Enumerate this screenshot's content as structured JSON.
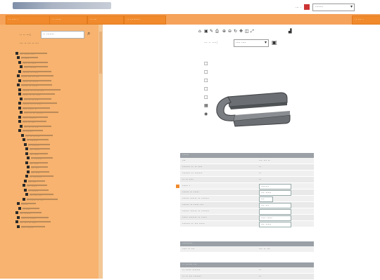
{
  "header": {
    "lang_label": "··· ·",
    "lang_value": "·······"
  },
  "nav": {
    "tabs": [
      "·· ···· ·",
      "·· ·····",
      "·· ···",
      "·· ·········"
    ],
    "right_tab": "·· ··· ·"
  },
  "sidebar": {
    "search_label": "·· ·· ···:",
    "search_value": "·· ·······",
    "hint": "··· ·· ··· ·· ···",
    "tree_items": [
      "··· ····· ···",
      "·· ····",
      "···· ·· ····",
      "···· ······",
      "······ ·· ····",
      "····· ··· ·· ···",
      "····· ·· ·····",
      "······ ·· ·····",
      "······ ·· ·· ·· ···",
      "····· ·· ·· ····",
      "··· ·· ·· ···",
      "······ ·· ·· ····",
      "···· ····· ··",
      "···· ·· ·· ······",
      "····· ······",
      "···· ·· ···",
      "··· ·· ·· ···",
      "·· ······",
      "··· ·· ·· ···",
      "·· ·······",
      "·· ·······",
      "··· ·····",
      "··· ····",
      "·· ·······",
      "··· ····",
      "··· ···",
      "··· ····",
      "·· ········",
      "··· ···",
      "··· ·····",
      "·· ······",
      "··· ··· ···",
      "·· ····· ·· ···",
      "······",
      "·· ····",
      "··· ······",
      "···· ·· ·····",
      "··· ··· ·· ····",
      "···· ······"
    ]
  },
  "viewer": {
    "zoom_label": "··· ·· ····:",
    "zoom_value": "···· ····"
  },
  "panels": [
    {
      "title": "······",
      "rows": [
        {
          "key": "···",
          "value": "··· ··· ··"
        },
        {
          "key": "······· ·· ·· ····",
          "value": "··"
        },
        {
          "key": "······· ·· ·······",
          "value": "··"
        },
        {
          "key": "·· ·· ····",
          "value": "··"
        },
        {
          "key": "····· ·",
          "value": "·······"
        },
        {
          "key": "······ ·· ·····",
          "value": "··· ·····"
        },
        {
          "key": "······ ······ ·· ·······",
          "value": "···"
        },
        {
          "key": "······ ·· ····· ···",
          "value": "··· ···"
        },
        {
          "key": "······ ······ ·· ·······",
          "value": ""
        },
        {
          "key": "····· ······· ·· ·····",
          "value": "···· ·····"
        },
        {
          "key": "······· ·· ··· ·····",
          "value": "··· ·····"
        }
      ]
    },
    {
      "title": "·········",
      "rows": [
        {
          "key": "···· ·· ···",
          "value": "··· ·· ···"
        }
      ]
    },
    {
      "title": "·· ······ ···",
      "rows": [
        {
          "key": "·· ····· ·······",
          "value": "··"
        },
        {
          "key": "·· ·· ··· ·······",
          "value": "··"
        }
      ]
    }
  ],
  "colors": {
    "accent": "#f08a2c",
    "sidebar": "#f7b36f",
    "panel_header": "#9aa0a6"
  }
}
